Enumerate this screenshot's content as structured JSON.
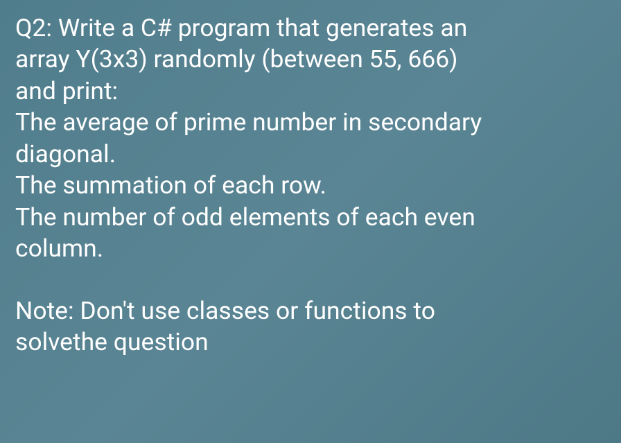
{
  "question": {
    "line1": "Q2: Write a C# program that generates an",
    "line2": "array Y(3x3) randomly (between 55, 666)",
    "line3": "and print:",
    "line4": " The average of prime number in secondary",
    "line5": "diagonal.",
    "line6": "The summation of each row.",
    "line7": "The number of odd elements of each even",
    "line8": "column.",
    "note1": "Note: Don't use classes or functions to",
    "note2": "solvethe question"
  }
}
